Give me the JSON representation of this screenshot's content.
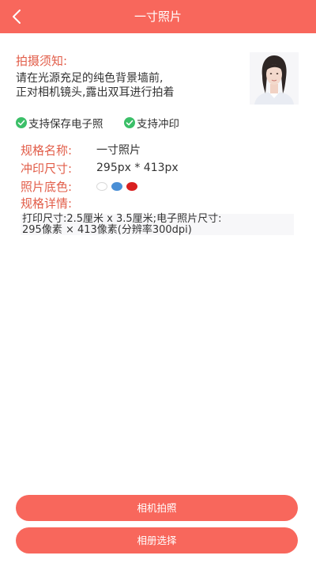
{
  "header": {
    "title": "一寸照片"
  },
  "notice": {
    "title": "拍摄须知:",
    "line1": "请在光源充足的纯色背景墙前,",
    "line2": "正对相机镜头,露出双耳进行拍着"
  },
  "features": [
    {
      "label": "支持保存电子照",
      "icon": "check-circle-icon"
    },
    {
      "label": "支持冲印",
      "icon": "check-circle-icon"
    }
  ],
  "spec": {
    "name_label": "规格名称:",
    "name_value": "一寸照片",
    "size_label": "冲印尺寸:",
    "size_value": "295px * 413px",
    "bg_label": "照片底色:",
    "bg_colors": [
      "#ffffff",
      "#4a8fd6",
      "#d91f1f"
    ],
    "details_label": "规格详情:",
    "details_line1": "打印尺寸:2.5厘米 x 3.5厘米;电子照片尺寸:",
    "details_line2": "295像素 × 413像素(分辨率300dpi)"
  },
  "actions": {
    "camera_label": "相机拍照",
    "album_label": "相册选择"
  },
  "colors": {
    "accent": "#f8675c",
    "label": "#e25e4a",
    "check": "#3bbf68"
  }
}
